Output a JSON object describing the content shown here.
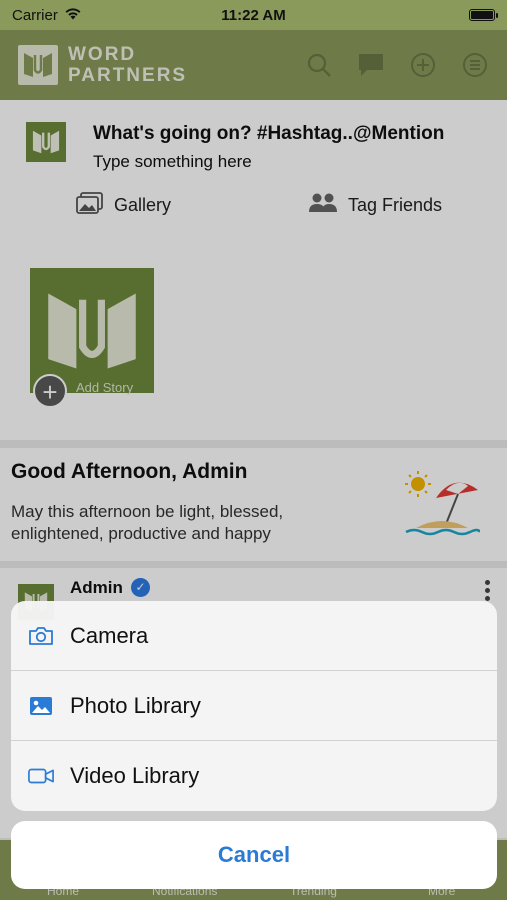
{
  "status_bar": {
    "carrier": "Carrier",
    "time": "11:22 AM"
  },
  "header": {
    "logo_line1": "WORD",
    "logo_line2": "PARTNERS"
  },
  "composer": {
    "title": "What's going on? #Hashtag..@Mention",
    "placeholder": "Type something here",
    "gallery_label": "Gallery",
    "tag_friends_label": "Tag Friends",
    "story_label": "Add Story"
  },
  "greeting": {
    "title": "Good Afternoon, Admin",
    "message": "May this afternoon be light, blessed, enlightened, productive and happy"
  },
  "post": {
    "author": "Admin"
  },
  "tabbar": {
    "items": [
      "Home",
      "Notifications",
      "Trending",
      "More"
    ]
  },
  "action_sheet": {
    "items": [
      {
        "label": "Camera",
        "icon": "camera-icon"
      },
      {
        "label": "Photo Library",
        "icon": "photo-icon"
      },
      {
        "label": "Video Library",
        "icon": "video-icon"
      }
    ],
    "cancel_label": "Cancel"
  },
  "colors": {
    "brand": "#8a9a5b",
    "logo_green": "#6f8a3e",
    "ios_blue": "#2a7bd5"
  }
}
